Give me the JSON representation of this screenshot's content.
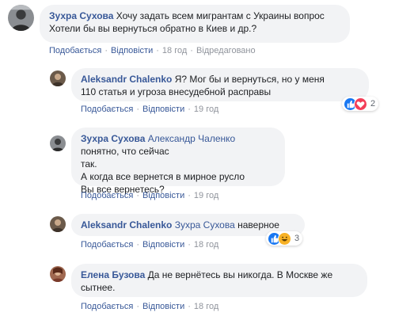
{
  "comments": [
    {
      "author": "Зухра Сухова",
      "mention": "",
      "text": "Хочу задать всем мигрантам с Украины вопрос\nХотели бы вы вернуться обратно в Киев и др.?",
      "actions": {
        "like": "Подобається",
        "reply": "Відповісти",
        "time": "18 год",
        "edited": "Відредаговано"
      }
    },
    {
      "author": "Aleksandr Chalenko",
      "mention": "",
      "text": "Я? Мог бы и вернуться, но у меня\n110 статья и угроза внесудебной расправы",
      "actions": {
        "like": "Подобається",
        "reply": "Відповісти",
        "time": "19 год"
      },
      "reactions": {
        "icons": [
          "like-icon",
          "love-icon"
        ],
        "count": "2"
      }
    },
    {
      "author": "Зухра Сухова",
      "mention": "Александр Чаленко",
      "text": " понятно, что сейчас\nтак.\nА когда все вернется в мирное русло\nВы все вернетесь?",
      "actions": {
        "like": "Подобається",
        "reply": "Відповісти",
        "time": "19 год"
      }
    },
    {
      "author": "Aleksandr Chalenko",
      "mention": "Зухра Сухова",
      "text": " наверное",
      "actions": {
        "like": "Подобається",
        "reply": "Відповісти",
        "time": "18 год"
      },
      "reactions": {
        "icons": [
          "like-icon",
          "haha-icon"
        ],
        "count": "3"
      }
    },
    {
      "author": "Елена Бузова",
      "mention": "",
      "text": "Да не вернётесь вы никогда. В Москве же\nсытнее.",
      "actions": {
        "like": "Подобається",
        "reply": "Відповісти",
        "time": "18 год"
      }
    }
  ],
  "colors": {
    "link": "#385898",
    "bubble": "#f2f3f5",
    "meta": "#90949c",
    "like": "#1877f2",
    "love": "#f33e58",
    "haha": "#f7b125"
  }
}
